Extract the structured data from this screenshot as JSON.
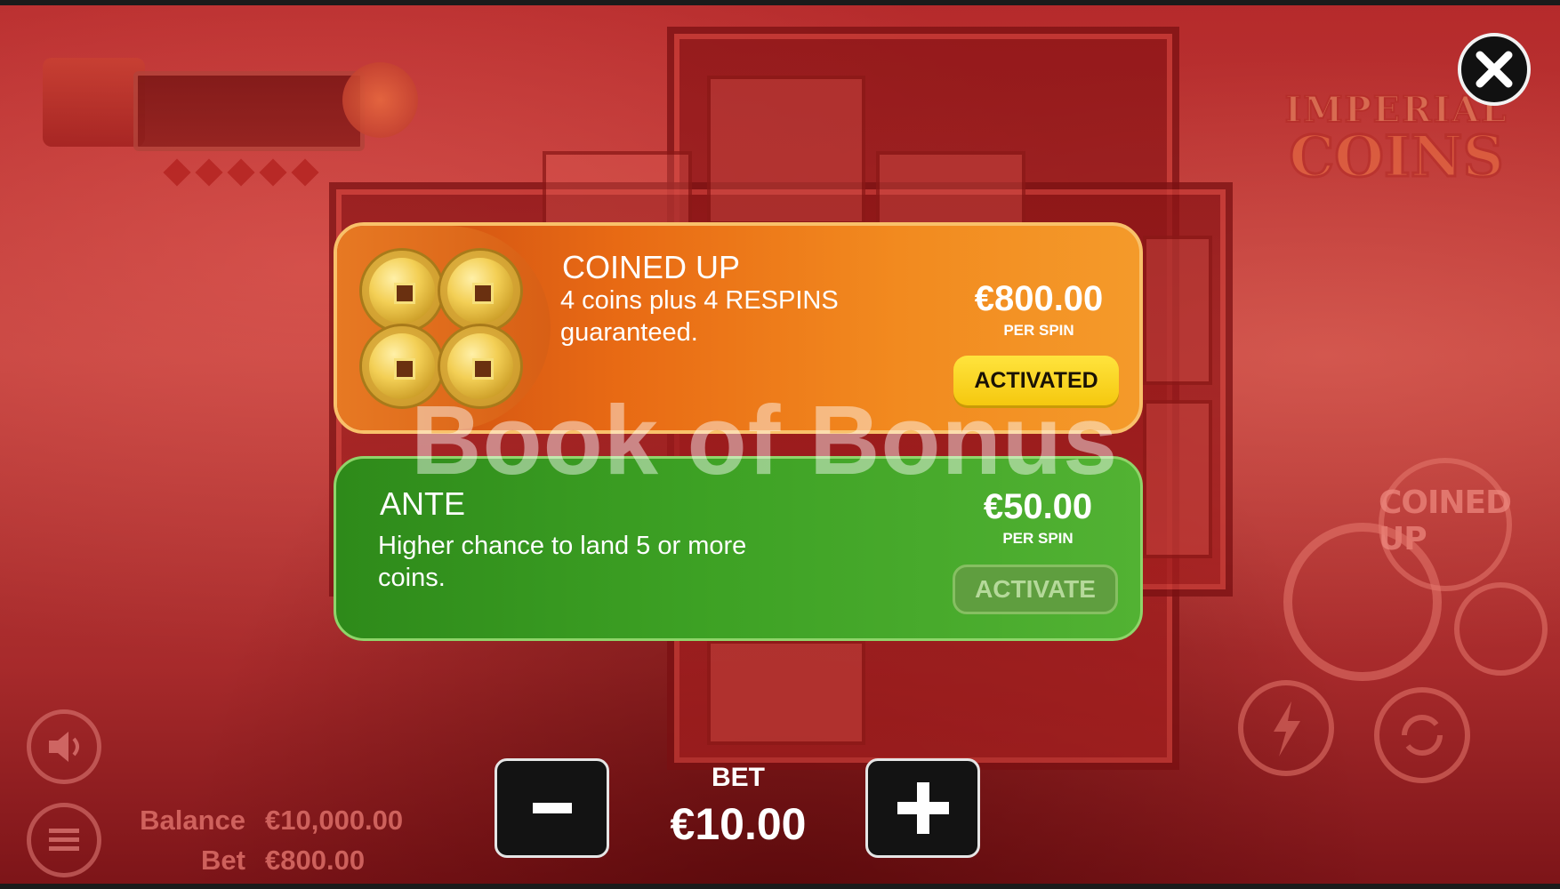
{
  "game": {
    "logo_line1": "IMPERIAL",
    "logo_line2": "COINS"
  },
  "close_icon": "close-icon",
  "side_controls": {
    "coined_up_label": "COINED UP"
  },
  "info": {
    "balance_label": "Balance",
    "balance_value": "€10,000.00",
    "bet_label": "Bet",
    "bet_value": "€800.00"
  },
  "ghost_bet_text": "800",
  "panels": {
    "coined_up": {
      "title": "COINED UP",
      "description": "4 coins plus 4 RESPINS guaranteed.",
      "price": "€800.00",
      "per_spin": "PER SPIN",
      "button_label": "ACTIVATED",
      "color": "#f0841c"
    },
    "ante": {
      "title": "ANTE",
      "description": "Higher chance to land 5 or more coins.",
      "price": "€50.00",
      "per_spin": "PER SPIN",
      "button_label": "ACTIVATE",
      "color": "#3da124"
    }
  },
  "watermark": "Book of Bonus",
  "bet_control": {
    "label": "BET",
    "value": "€10.00",
    "minus_label": "-",
    "plus_label": "+"
  }
}
